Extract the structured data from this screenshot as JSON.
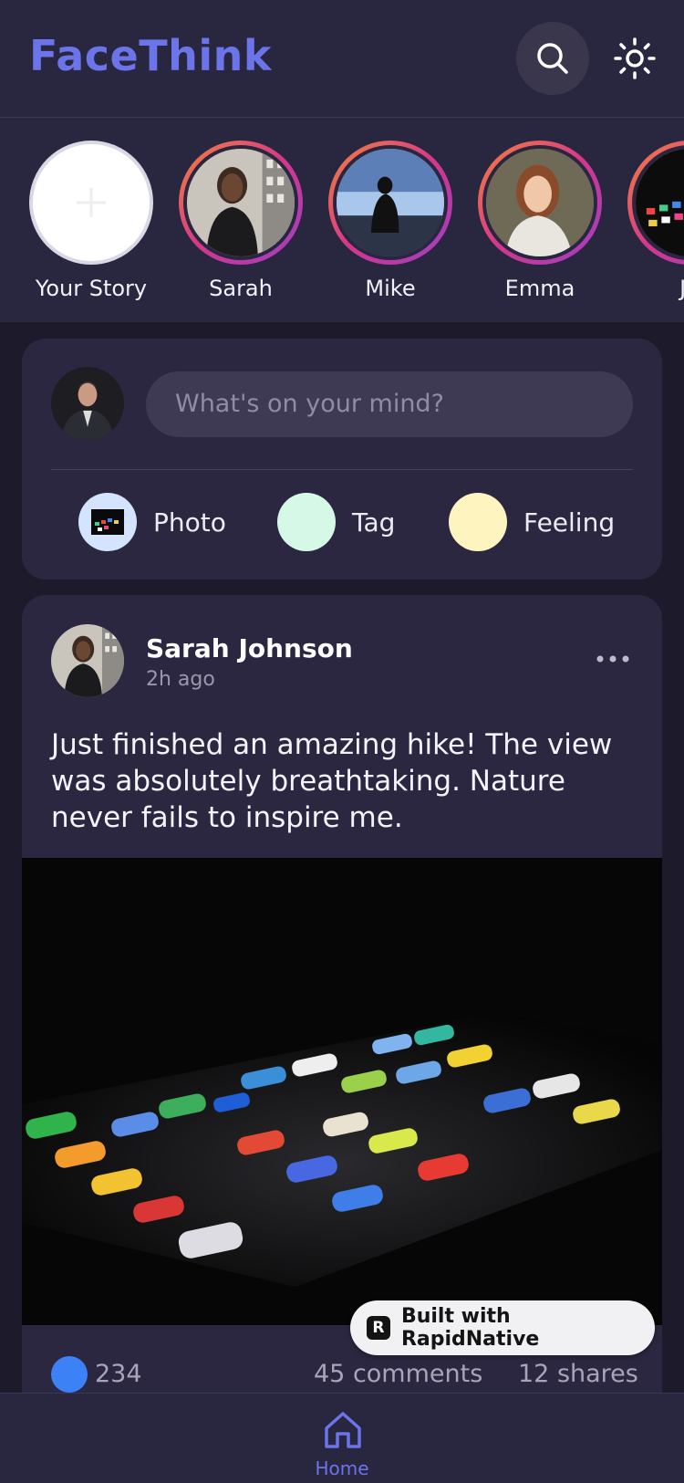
{
  "header": {
    "logo": "FaceThink",
    "search_icon": "search-icon",
    "theme_icon": "sun-icon"
  },
  "stories": [
    {
      "label": "Your Story",
      "kind": "add"
    },
    {
      "label": "Sarah"
    },
    {
      "label": "Mike"
    },
    {
      "label": "Emma"
    },
    {
      "label": "Jo"
    }
  ],
  "composer": {
    "placeholder": "What's on your mind?",
    "actions": [
      {
        "label": "Photo",
        "color": "#d4e4ff"
      },
      {
        "label": "Tag",
        "color": "#d6f8e6"
      },
      {
        "label": "Feeling",
        "color": "#fdf4bf"
      }
    ]
  },
  "post": {
    "author": "Sarah Johnson",
    "time": "2h ago",
    "text": "Just finished an amazing hike! The view was absolutely breathtaking. Nature never fails to inspire me.",
    "likes": "234",
    "comments": "45 comments",
    "shares": "12 shares"
  },
  "badge": {
    "label": "Built with RapidNative"
  },
  "nav": {
    "home_label": "Home"
  },
  "colors": {
    "accent": "#6b74e8",
    "background": "#1c1a2b",
    "surface": "#2b2740",
    "like": "#3c82f6"
  }
}
